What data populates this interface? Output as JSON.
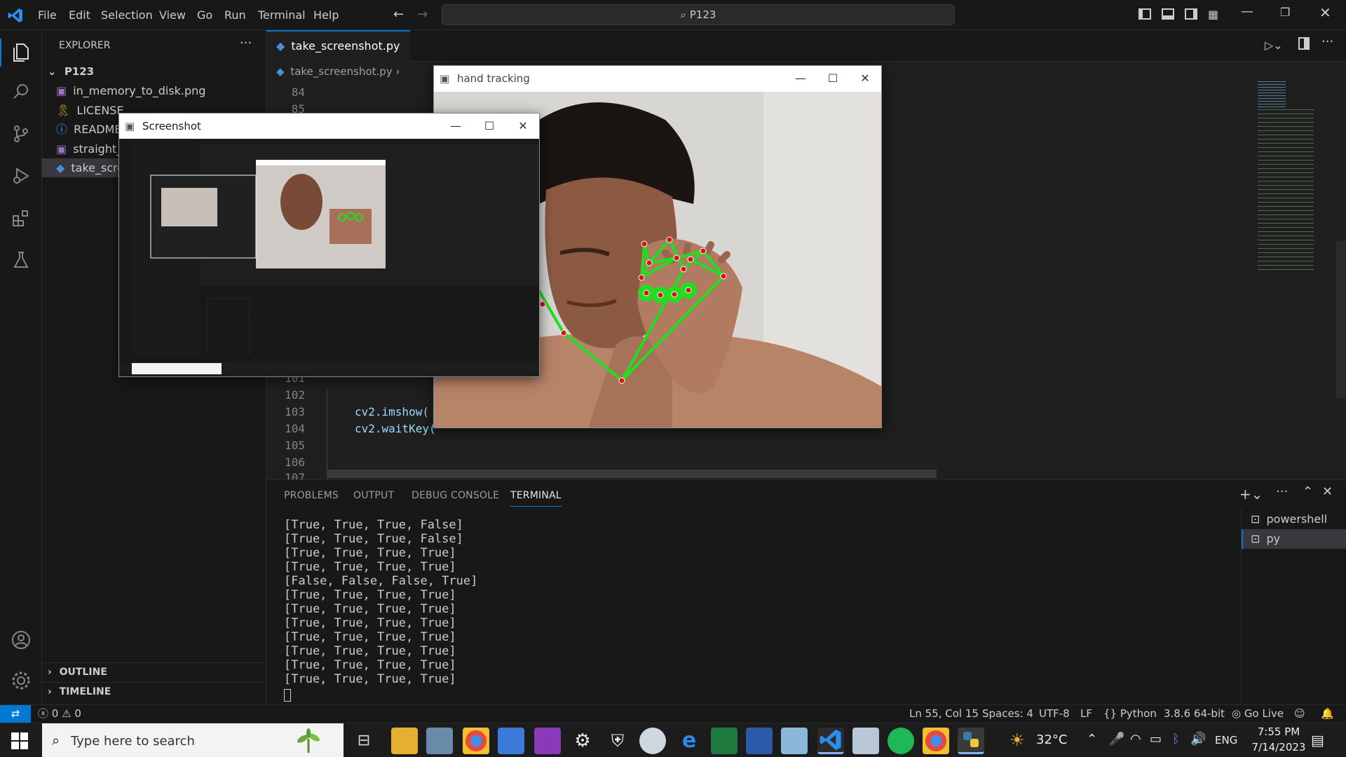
{
  "menu": [
    "File",
    "Edit",
    "Selection",
    "View",
    "Go",
    "Run",
    "Terminal",
    "Help"
  ],
  "command_center": "P123",
  "explorer": {
    "title": "EXPLORER",
    "folder": "P123",
    "files": [
      "in_memory_to_disk.png",
      "LICENSE",
      "README.md",
      "straight_t",
      "take_scre"
    ],
    "outline": "OUTLINE",
    "timeline": "TIMELINE"
  },
  "editor": {
    "tab": "take_screenshot.py",
    "breadcrumb": "take_screenshot.py",
    "lines": [
      {
        "n": "84",
        "code": ""
      },
      {
        "n": "85",
        "code": ""
      },
      {
        "n": "101",
        "code": ""
      },
      {
        "n": "102",
        "code": ""
      },
      {
        "n": "103",
        "code": "cv2.imshow("
      },
      {
        "n": "104",
        "code": "cv2.waitKey("
      },
      {
        "n": "105",
        "code": ""
      },
      {
        "n": "106",
        "code": ""
      },
      {
        "n": "107",
        "code": ""
      }
    ]
  },
  "panel": {
    "tabs": [
      "PROBLEMS",
      "OUTPUT",
      "DEBUG CONSOLE",
      "TERMINAL"
    ],
    "active_tab": "TERMINAL",
    "terminal_lines": [
      "[True, True, True, False]",
      "[True, True, True, False]",
      "[True, True, True, True]",
      "[True, True, True, True]",
      "[False, False, False, True]",
      "[True, True, True, True]",
      "[True, True, True, True]",
      "[True, True, True, True]",
      "[True, True, True, True]",
      "[True, True, True, True]",
      "[True, True, True, True]",
      "[True, True, True, True]"
    ],
    "terminals": [
      "powershell",
      "py"
    ]
  },
  "status": {
    "errors": "0",
    "warnings": "0",
    "position": "Ln 55, Col 15",
    "spaces": "Spaces: 4",
    "encoding": "UTF-8",
    "eol": "LF",
    "language": "Python",
    "interpreter": "3.8.6 64-bit",
    "golive": "Go Live"
  },
  "windows": {
    "hand": {
      "title": "hand tracking"
    },
    "shot": {
      "title": "Screenshot"
    }
  },
  "taskbar": {
    "search_placeholder": "Type here to search",
    "weather": "32°C",
    "lang": "ENG",
    "time": "7:55 PM",
    "date": "7/14/2023"
  },
  "colors": {
    "accent": "#0078d4",
    "landmark": "#e01010",
    "skeleton": "#22dd22"
  }
}
